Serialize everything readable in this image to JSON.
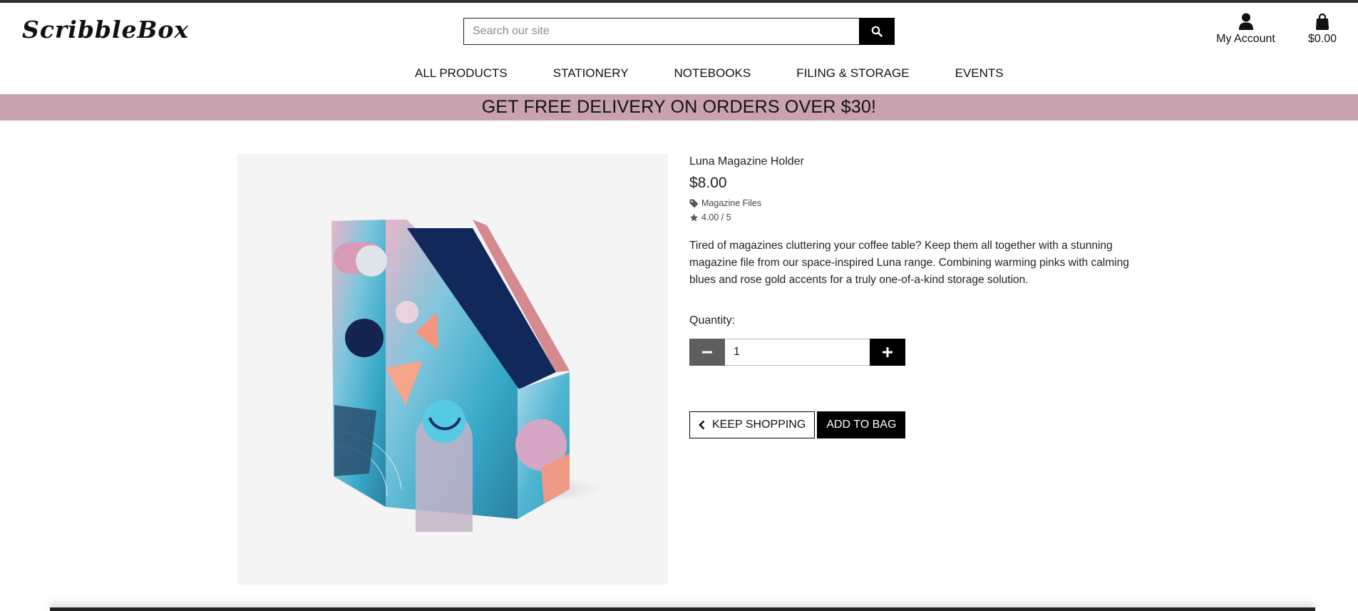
{
  "brand": {
    "logo": "ScribbleBox"
  },
  "search": {
    "placeholder": "Search our site",
    "icon": "search-icon"
  },
  "header": {
    "account_label": "My Account",
    "account_icon": "user-icon",
    "bag_total": "$0.00",
    "bag_icon": "shopping-bag-icon"
  },
  "nav": {
    "items": [
      "ALL PRODUCTS",
      "STATIONERY",
      "NOTEBOOKS",
      "FILING & STORAGE",
      "EVENTS"
    ]
  },
  "banner": {
    "text": "GET FREE DELIVERY ON ORDERS OVER $30!",
    "color": "#c8a2ae"
  },
  "product": {
    "name": "Luna Magazine Holder",
    "price": "$8.00",
    "category": "Magazine Files",
    "category_icon": "tag-icon",
    "rating": "4.00 / 5",
    "rating_icon": "star-icon",
    "description": "Tired of magazines cluttering your coffee table? Keep them all together with a stunning magazine file from our space-inspired Luna range. Combining warming pinks with calming blues and rose gold accents for a truly one-of-a-kind storage solution.",
    "quantity_label": "Quantity:",
    "quantity": "1"
  },
  "actions": {
    "keep_shopping": "KEEP SHOPPING",
    "add_to_bag": "ADD TO BAG"
  }
}
